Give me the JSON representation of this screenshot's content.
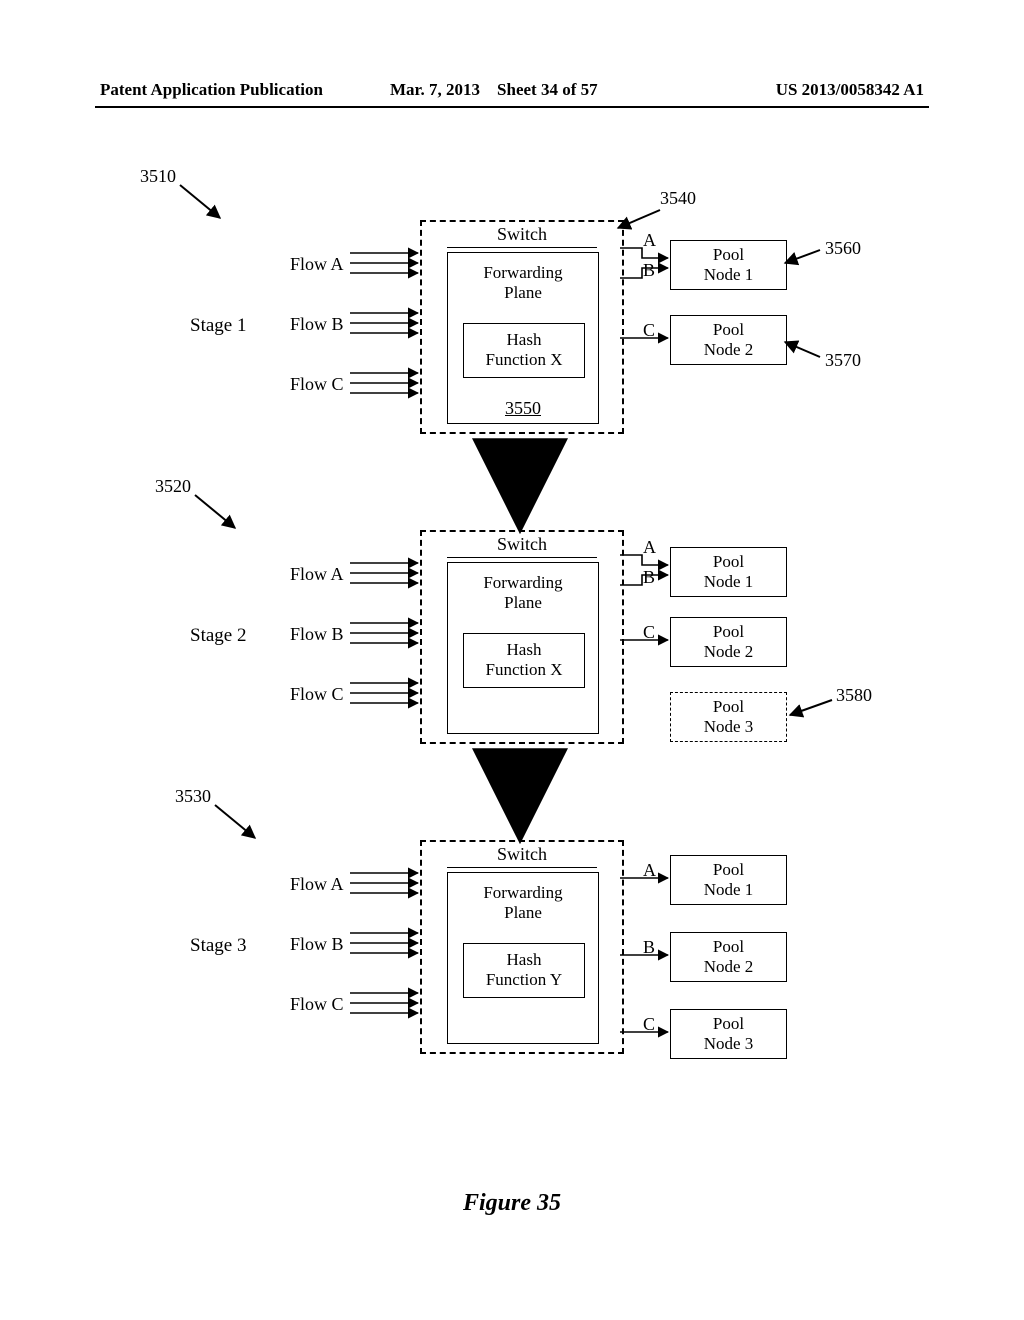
{
  "header": {
    "left": "Patent Application Publication",
    "date": "Mar. 7, 2013",
    "sheet": "Sheet 34 of 57",
    "pubno": "US 2013/0058342 A1"
  },
  "figure_caption": "Figure 35",
  "refs": {
    "r3510": "3510",
    "r3520": "3520",
    "r3530": "3530",
    "r3540": "3540",
    "r3550": "3550",
    "r3560": "3560",
    "r3570": "3570",
    "r3580": "3580"
  },
  "common": {
    "switch": "Switch",
    "fp": "Forwarding\nPlane",
    "flowA": "Flow A",
    "flowB": "Flow B",
    "flowC": "Flow C",
    "outA": "A",
    "outB": "B",
    "outC": "C",
    "pool1": "Pool\nNode 1",
    "pool2": "Pool\nNode 2",
    "pool3": "Pool\nNode 3",
    "hashX": "Hash\nFunction X",
    "hashY": "Hash\nFunction Y"
  },
  "stages": {
    "s1": "Stage 1",
    "s2": "Stage 2",
    "s3": "Stage 3"
  },
  "chart_data": {
    "type": "table",
    "title": "Figure 35 – Flow-to-Pool-Node mapping across stages",
    "flows": [
      "A",
      "B",
      "C"
    ],
    "stages": [
      {
        "name": "Stage 1",
        "ref": 3510,
        "hash_function": "X",
        "pool_nodes": [
          "Pool Node 1",
          "Pool Node 2"
        ],
        "mapping": {
          "A": "Pool Node 1",
          "B": "Pool Node 1",
          "C": "Pool Node 2"
        }
      },
      {
        "name": "Stage 2",
        "ref": 3520,
        "hash_function": "X",
        "pool_nodes": [
          "Pool Node 1",
          "Pool Node 2",
          "Pool Node 3"
        ],
        "added_node": "Pool Node 3",
        "added_node_ref": 3580,
        "mapping": {
          "A": "Pool Node 1",
          "B": "Pool Node 1",
          "C": "Pool Node 2"
        }
      },
      {
        "name": "Stage 3",
        "ref": 3530,
        "hash_function": "Y",
        "pool_nodes": [
          "Pool Node 1",
          "Pool Node 2",
          "Pool Node 3"
        ],
        "mapping": {
          "A": "Pool Node 1",
          "B": "Pool Node 2",
          "C": "Pool Node 3"
        }
      }
    ]
  }
}
